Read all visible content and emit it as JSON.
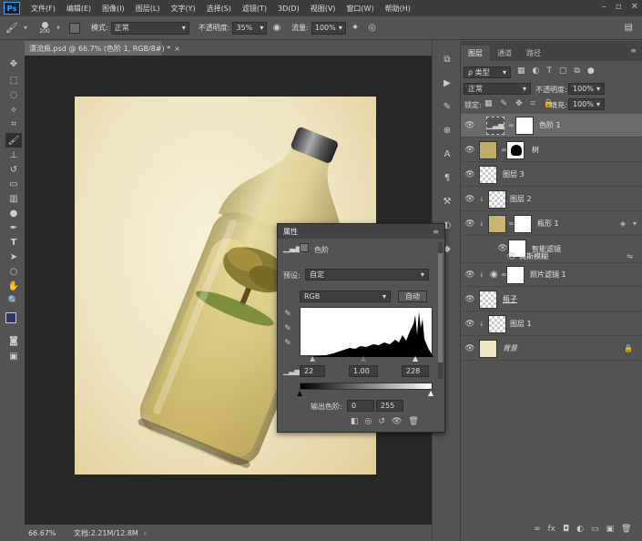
{
  "menubar": {
    "logo": "Ps",
    "items": [
      "文件(F)",
      "编辑(E)",
      "图像(I)",
      "图层(L)",
      "文字(Y)",
      "选择(S)",
      "滤镜(T)",
      "3D(D)",
      "视图(V)",
      "窗口(W)",
      "帮助(H)"
    ]
  },
  "options": {
    "brush_size": "200",
    "mode_label": "模式:",
    "mode_value": "正常",
    "opacity_label": "不透明度:",
    "opacity_value": "35%",
    "flow_label": "流量:",
    "flow_value": "100%"
  },
  "doc": {
    "tab_title": "漂流瓶.psd @ 66.7% (色阶 1, RGB/8#) *"
  },
  "status": {
    "zoom": "66.67%",
    "doc_size": "文档:2.21M/12.8M"
  },
  "layers_panel": {
    "tabs": [
      "图层",
      "通道",
      "路径"
    ],
    "filter_kind": "ρ 类型",
    "blend_mode": "正常",
    "opacity_label": "不透明度:",
    "opacity_value": "100%",
    "lock_label": "锁定:",
    "fill_label": "填充:",
    "fill_value": "100%",
    "layers": [
      {
        "name": "色阶 1",
        "selected": true
      },
      {
        "name": "树"
      },
      {
        "name": "图层 3"
      },
      {
        "name": "图层 2"
      },
      {
        "name": "瓶形 1"
      },
      {
        "name": "智能滤镜"
      },
      {
        "name": "高斯模糊"
      },
      {
        "name": "照片滤镜 1"
      },
      {
        "name": "瓶子"
      },
      {
        "name": "图层 1"
      },
      {
        "name": "背景"
      }
    ]
  },
  "properties": {
    "title": "属性",
    "subtitle": "色阶",
    "preset_label": "预设:",
    "preset_value": "自定",
    "channel": "RGB",
    "auto_label": "自动",
    "input_black": "22",
    "input_mid": "1.00",
    "input_white": "228",
    "output_label": "输出色阶:",
    "output_black": "0",
    "output_white": "255"
  }
}
